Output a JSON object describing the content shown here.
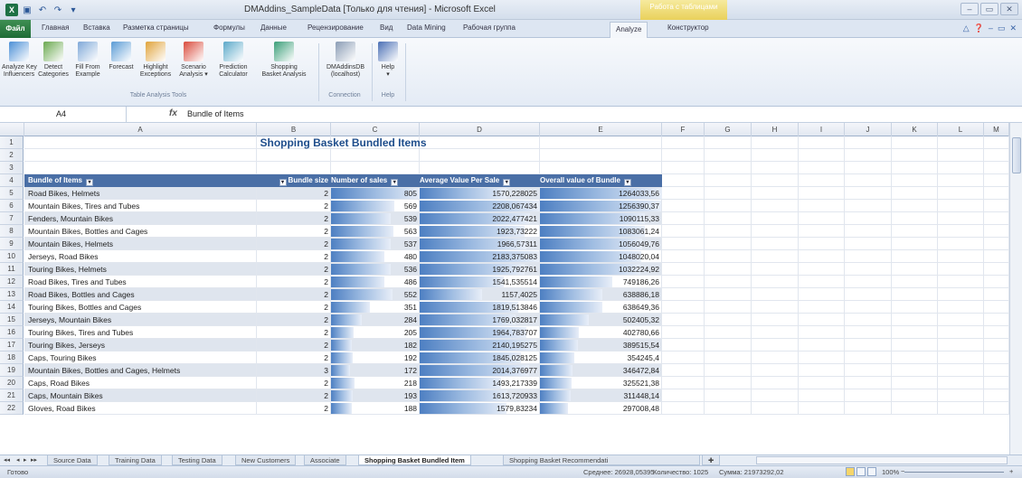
{
  "window": {
    "title": "DMAddins_SampleData [Только для чтения] - Microsoft Excel",
    "context_tab_group": "Работа с таблицами"
  },
  "tabs": [
    "Файл",
    "Главная",
    "Вставка",
    "Разметка страницы",
    "Формулы",
    "Данные",
    "Рецензирование",
    "Вид",
    "Data Mining",
    "Рабочая группа",
    "Analyze",
    "Конструктор"
  ],
  "ribbon": {
    "buttons": [
      {
        "label": "Analyze Key\nInfluencers",
        "icon": "key-influencers-icon",
        "color": "#4b8fd6"
      },
      {
        "label": "Detect\nCategories",
        "icon": "detect-categories-icon",
        "color": "#6aa84f"
      },
      {
        "label": "Fill From\nExample",
        "icon": "fill-from-example-icon",
        "color": "#7fa8d8"
      },
      {
        "label": "Forecast",
        "icon": "forecast-icon",
        "color": "#5a9bd5"
      },
      {
        "label": "Highlight\nExceptions",
        "icon": "highlight-exceptions-icon",
        "color": "#e0a33a"
      },
      {
        "label": "Scenario\nAnalysis ▾",
        "icon": "scenario-analysis-icon",
        "color": "#d94a3b"
      },
      {
        "label": "Prediction\nCalculator",
        "icon": "prediction-calculator-icon",
        "color": "#5ba8c9"
      },
      {
        "label": "Shopping\nBasket Analysis",
        "icon": "shopping-basket-icon",
        "color": "#3a9e78"
      },
      {
        "label": "DMAddinsDB\n(localhost)",
        "icon": "connection-icon",
        "color": "#8a9cb5"
      },
      {
        "label": "Help\n▾",
        "icon": "help-icon",
        "color": "#4a6fb5"
      }
    ],
    "groups": [
      "Table Analysis Tools",
      "Connection",
      "Help"
    ]
  },
  "formula_bar": {
    "name_box": "A4",
    "fx": "fx",
    "content": "Bundle of Items"
  },
  "columns": [
    "A",
    "B",
    "C",
    "D",
    "E",
    "F",
    "G",
    "H",
    "I",
    "J",
    "K",
    "L",
    "M"
  ],
  "sheet_title": "Shopping Basket Bundled Items",
  "table": {
    "headers": [
      "Bundle of Items",
      "Bundle size",
      "Number of sales",
      "Average Value Per Sale",
      "Overall value of Bundle"
    ],
    "rows": [
      {
        "n": 5,
        "items": "Road Bikes, Helmets",
        "size": "2",
        "sales": "805",
        "avg": "1570,228025",
        "overall": "1264033,56",
        "sales_frac": 1.0,
        "avg_frac": 0.72,
        "overall_frac": 1.0
      },
      {
        "n": 6,
        "items": "Mountain Bikes, Tires and Tubes",
        "size": "2",
        "sales": "569",
        "avg": "2208,067434",
        "overall": "1256390,37",
        "sales_frac": 0.71,
        "avg_frac": 1.0,
        "overall_frac": 0.99
      },
      {
        "n": 7,
        "items": "Fenders, Mountain Bikes",
        "size": "2",
        "sales": "539",
        "avg": "2022,477421",
        "overall": "1090115,33",
        "sales_frac": 0.67,
        "avg_frac": 0.92,
        "overall_frac": 0.86
      },
      {
        "n": 8,
        "items": "Mountain Bikes, Bottles and Cages",
        "size": "2",
        "sales": "563",
        "avg": "1923,73222",
        "overall": "1083061,24",
        "sales_frac": 0.7,
        "avg_frac": 0.87,
        "overall_frac": 0.86
      },
      {
        "n": 9,
        "items": "Mountain Bikes, Helmets",
        "size": "2",
        "sales": "537",
        "avg": "1966,57311",
        "overall": "1056049,76",
        "sales_frac": 0.67,
        "avg_frac": 0.89,
        "overall_frac": 0.84
      },
      {
        "n": 10,
        "items": "Jerseys, Road Bikes",
        "size": "2",
        "sales": "480",
        "avg": "2183,375083",
        "overall": "1048020,04",
        "sales_frac": 0.6,
        "avg_frac": 0.99,
        "overall_frac": 0.83
      },
      {
        "n": 11,
        "items": "Touring Bikes, Helmets",
        "size": "2",
        "sales": "536",
        "avg": "1925,792761",
        "overall": "1032224,92",
        "sales_frac": 0.67,
        "avg_frac": 0.87,
        "overall_frac": 0.82
      },
      {
        "n": 12,
        "items": "Road Bikes, Tires and Tubes",
        "size": "2",
        "sales": "486",
        "avg": "1541,535514",
        "overall": "749186,26",
        "sales_frac": 0.6,
        "avg_frac": 0.7,
        "overall_frac": 0.59
      },
      {
        "n": 13,
        "items": "Road Bikes, Bottles and Cages",
        "size": "2",
        "sales": "552",
        "avg": "1157,4025",
        "overall": "638886,18",
        "sales_frac": 0.69,
        "avg_frac": 0.52,
        "overall_frac": 0.51
      },
      {
        "n": 14,
        "items": "Touring Bikes, Bottles and Cages",
        "size": "2",
        "sales": "351",
        "avg": "1819,513846",
        "overall": "638649,36",
        "sales_frac": 0.44,
        "avg_frac": 0.82,
        "overall_frac": 0.51
      },
      {
        "n": 15,
        "items": "Jerseys, Mountain Bikes",
        "size": "2",
        "sales": "284",
        "avg": "1769,032817",
        "overall": "502405,32",
        "sales_frac": 0.35,
        "avg_frac": 0.8,
        "overall_frac": 0.4
      },
      {
        "n": 16,
        "items": "Touring Bikes, Tires and Tubes",
        "size": "2",
        "sales": "205",
        "avg": "1964,783707",
        "overall": "402780,66",
        "sales_frac": 0.25,
        "avg_frac": 0.89,
        "overall_frac": 0.32
      },
      {
        "n": 17,
        "items": "Touring Bikes, Jerseys",
        "size": "2",
        "sales": "182",
        "avg": "2140,195275",
        "overall": "389515,54",
        "sales_frac": 0.23,
        "avg_frac": 0.97,
        "overall_frac": 0.31
      },
      {
        "n": 18,
        "items": "Caps, Touring Bikes",
        "size": "2",
        "sales": "192",
        "avg": "1845,028125",
        "overall": "354245,4",
        "sales_frac": 0.24,
        "avg_frac": 0.84,
        "overall_frac": 0.28
      },
      {
        "n": 19,
        "items": "Mountain Bikes, Bottles and Cages, Helmets",
        "size": "3",
        "sales": "172",
        "avg": "2014,376977",
        "overall": "346472,84",
        "sales_frac": 0.21,
        "avg_frac": 0.91,
        "overall_frac": 0.27
      },
      {
        "n": 20,
        "items": "Caps, Road Bikes",
        "size": "2",
        "sales": "218",
        "avg": "1493,217339",
        "overall": "325521,38",
        "sales_frac": 0.27,
        "avg_frac": 0.68,
        "overall_frac": 0.26
      },
      {
        "n": 21,
        "items": "Caps, Mountain Bikes",
        "size": "2",
        "sales": "193",
        "avg": "1613,720933",
        "overall": "311448,14",
        "sales_frac": 0.24,
        "avg_frac": 0.73,
        "overall_frac": 0.25
      },
      {
        "n": 22,
        "items": "Gloves, Road Bikes",
        "size": "2",
        "sales": "188",
        "avg": "1579,83234",
        "overall": "297008,48",
        "sales_frac": 0.23,
        "avg_frac": 0.72,
        "overall_frac": 0.23
      }
    ]
  },
  "sheets": [
    "Source Data",
    "Training Data",
    "Testing Data",
    "New Customers",
    "Associate",
    "Shopping Basket Bundled Item",
    "Shopping Basket Recommendati"
  ],
  "active_sheet": "Shopping Basket Bundled Item",
  "status": {
    "ready": "Готово",
    "average": "Среднее: 26928,05395",
    "count": "Количество: 1025",
    "sum": "Сумма: 21973292,02",
    "zoom": "100%"
  }
}
